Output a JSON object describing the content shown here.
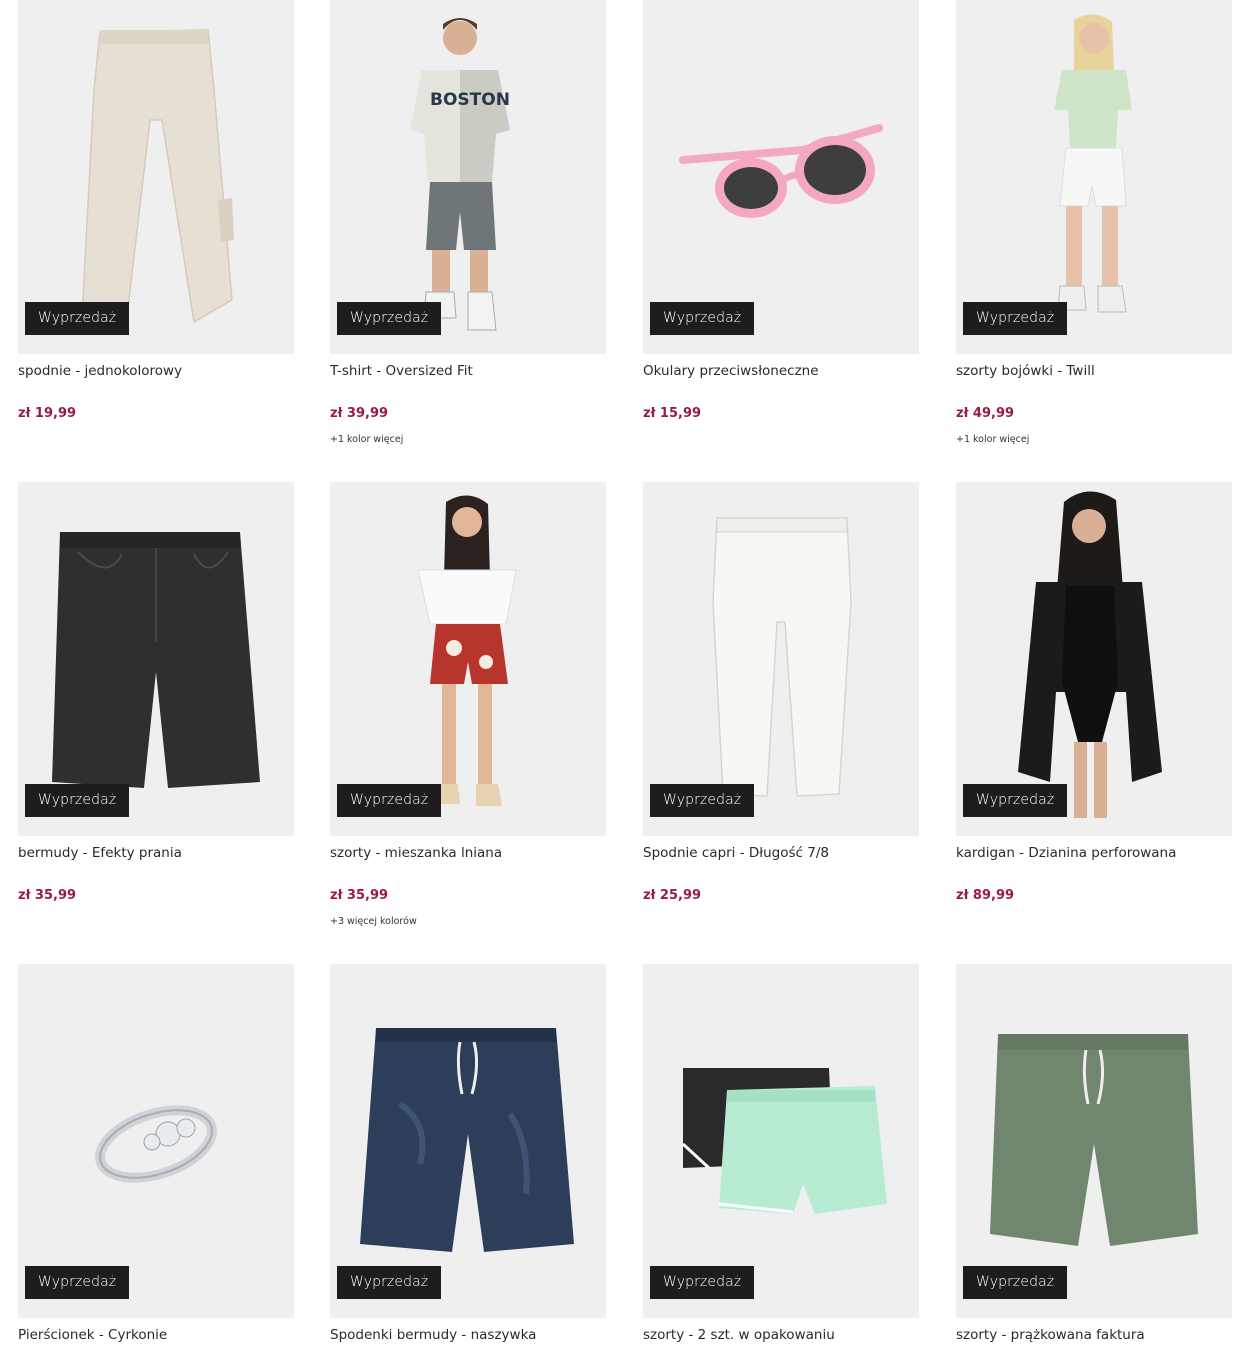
{
  "colors": {
    "price": "#9b1c3e",
    "badge_bg": "#1e1c1c",
    "image_bg": "#efefef"
  },
  "products": [
    {
      "name": "spodnie - jednokolorowy",
      "price": "zł 19,99",
      "more": "",
      "badge": "Wyprzedaż",
      "image": "beige-wide-trousers"
    },
    {
      "name": "T-shirt - Oversized Fit",
      "price": "zł 39,99",
      "more": "+1 kolor więcej",
      "badge": "Wyprzedaż",
      "image": "man-boston-tshirt-shorts"
    },
    {
      "name": "Okulary przeciwsłoneczne",
      "price": "zł 15,99",
      "more": "",
      "badge": "Wyprzedaż",
      "image": "pink-sunglasses"
    },
    {
      "name": "szorty bojówki - Twill",
      "price": "zł 49,99",
      "more": "+1 kolor więcej",
      "badge": "Wyprzedaż",
      "image": "woman-white-cargo-shorts"
    },
    {
      "name": "bermudy - Efekty prania",
      "price": "zł 35,99",
      "more": "",
      "badge": "Wyprzedaż",
      "image": "black-denim-bermudas"
    },
    {
      "name": "szorty - mieszanka lniana",
      "price": "zł 35,99",
      "more": "+3 więcej kolorów",
      "badge": "Wyprzedaż",
      "image": "woman-red-floral-shorts"
    },
    {
      "name": "Spodnie capri - Długość 7/8",
      "price": "zł 25,99",
      "more": "",
      "badge": "Wyprzedaż",
      "image": "white-capri-leggings"
    },
    {
      "name": "kardigan - Dzianina perforowana",
      "price": "zł 89,99",
      "more": "",
      "badge": "Wyprzedaż",
      "image": "woman-black-cardigan-swimsuit"
    },
    {
      "name": "Pierścionek - Cyrkonie",
      "price": "",
      "more": "",
      "badge": "Wyprzedaż",
      "image": "silver-zircon-ring"
    },
    {
      "name": "Spodenki bermudy - naszywka",
      "price": "",
      "more": "",
      "badge": "Wyprzedaż",
      "image": "navy-leaf-print-bermudas"
    },
    {
      "name": "szorty - 2 szt. w opakowaniu",
      "price": "",
      "more": "",
      "badge": "Wyprzedaż",
      "image": "black-and-mint-shorts-set"
    },
    {
      "name": "szorty - prążkowana faktura",
      "price": "",
      "more": "",
      "badge": "Wyprzedaż",
      "image": "green-ribbed-shorts"
    }
  ]
}
